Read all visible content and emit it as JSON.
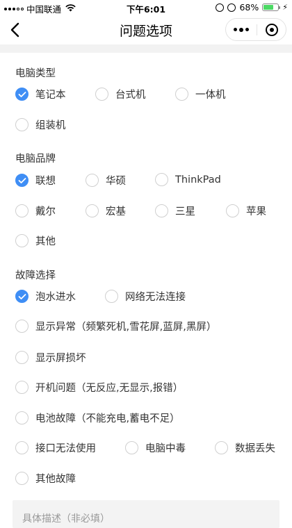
{
  "status_bar": {
    "carrier": "中国联通",
    "time": "下午6:01",
    "battery": "68%"
  },
  "nav": {
    "title": "问题选项"
  },
  "sections": [
    {
      "title": "电脑类型",
      "options": [
        {
          "label": "笔记本",
          "checked": true
        },
        {
          "label": "台式机",
          "checked": false
        },
        {
          "label": "一体机",
          "checked": false
        },
        {
          "label": "组装机",
          "checked": false
        }
      ]
    },
    {
      "title": "电脑品牌",
      "options": [
        {
          "label": "联想",
          "checked": true
        },
        {
          "label": "华硕",
          "checked": false
        },
        {
          "label": "ThinkPad",
          "checked": false
        },
        {
          "label": "戴尔",
          "checked": false
        },
        {
          "label": "宏基",
          "checked": false
        },
        {
          "label": "三星",
          "checked": false
        },
        {
          "label": "苹果",
          "checked": false
        },
        {
          "label": "其他",
          "checked": false
        }
      ]
    },
    {
      "title": "故障选择",
      "options": [
        {
          "label": "泡水进水",
          "checked": true
        },
        {
          "label": "网络无法连接",
          "checked": false
        },
        {
          "label": "显示异常（频繁死机,雪花屏,蓝屏,黑屏）",
          "checked": false
        },
        {
          "label": "显示屏损坏",
          "checked": false
        },
        {
          "label": "开机问题（无反应,无显示,报错）",
          "checked": false
        },
        {
          "label": "电池故障（不能充电,蓄电不足）",
          "checked": false
        },
        {
          "label": "接口无法使用",
          "checked": false
        },
        {
          "label": "电脑中毒",
          "checked": false
        },
        {
          "label": "数据丢失",
          "checked": false
        },
        {
          "label": "其他故障",
          "checked": false
        }
      ]
    }
  ],
  "description": {
    "placeholder": "具体描述（非必填）"
  },
  "colors": {
    "accent": "#3f8ef5",
    "section_band": "#f2f2f2"
  }
}
